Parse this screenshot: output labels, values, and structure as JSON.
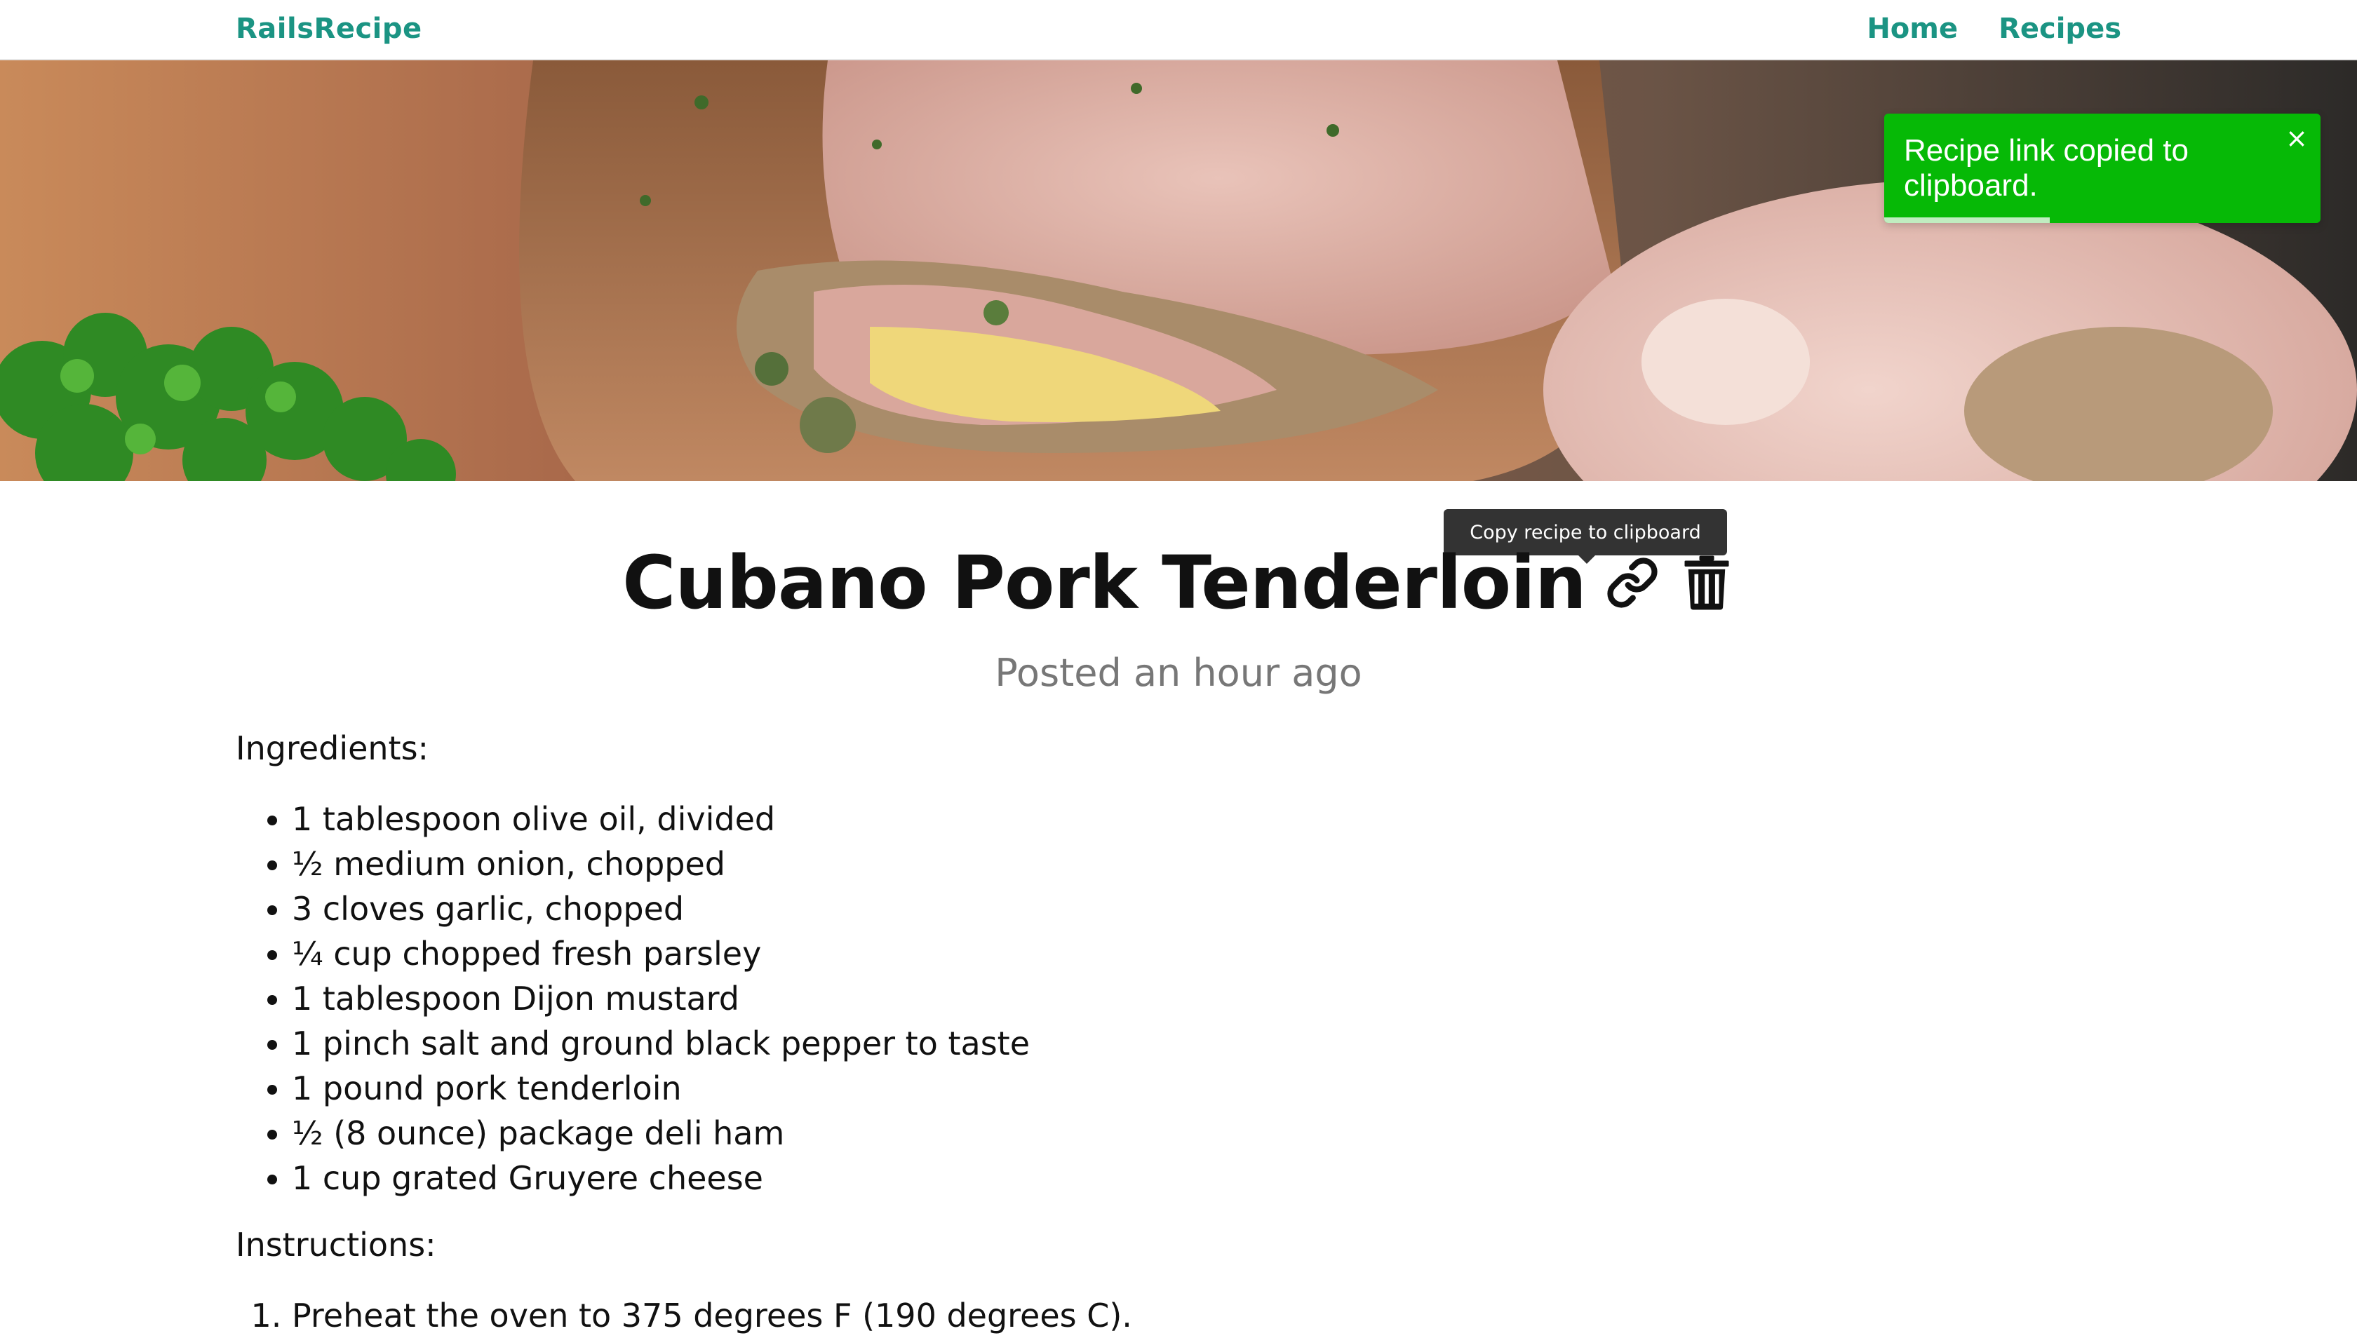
{
  "header": {
    "brand": "RailsRecipe",
    "nav": [
      {
        "label": "Home"
      },
      {
        "label": "Recipes"
      }
    ]
  },
  "toast": {
    "message": "Recipe link copied to clipboard.",
    "close_label": "×",
    "progress_fraction": 0.38,
    "background": "#06b906"
  },
  "tooltip": {
    "text": "Copy recipe to clipboard"
  },
  "recipe": {
    "title": "Cubano Pork Tenderloin",
    "posted": "Posted an hour ago",
    "ingredients_label": "Ingredients:",
    "ingredients": [
      "1 tablespoon olive oil, divided",
      "½ medium onion, chopped",
      "3 cloves garlic, chopped",
      "¼ cup chopped fresh parsley",
      "1 tablespoon Dijon mustard",
      "1 pinch salt and ground black pepper to taste",
      "1 pound pork tenderloin",
      "½ (8 ounce) package deli ham",
      "1 cup grated Gruyere cheese"
    ],
    "instructions_label": "Instructions:",
    "instructions": [
      "Preheat the oven to 375 degrees F (190 degrees C)."
    ]
  },
  "icons": {
    "copy": "link-icon",
    "delete": "trash-icon",
    "close": "close-icon"
  },
  "colors": {
    "brand": "#1b9483",
    "toast": "#06b906",
    "tooltip": "#333333"
  }
}
